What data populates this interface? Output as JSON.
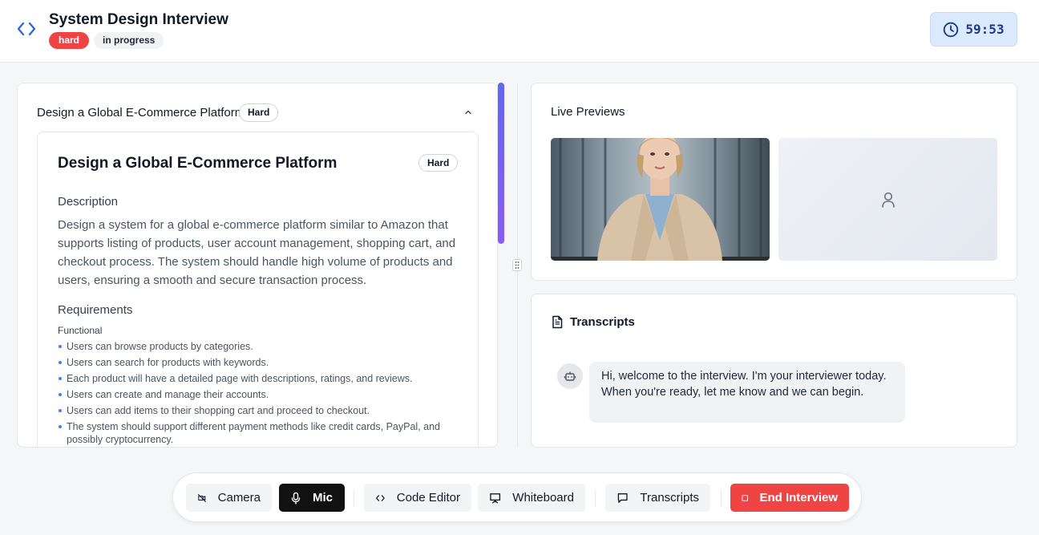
{
  "header": {
    "title": "System Design Interview",
    "difficulty_badge": "hard",
    "status_badge": "in progress",
    "timer": "59:53"
  },
  "problem": {
    "header_title": "Design a Global E-Commerce Platform",
    "header_badge": "Hard",
    "title": "Design a Global E-Commerce Platform",
    "badge": "Hard",
    "description_heading": "Description",
    "description": "Design a system for a global e-commerce platform similar to Amazon that supports listing of products, user account management, shopping cart, and checkout process. The system should handle high volume of products and users, ensuring a smooth and secure transaction process.",
    "requirements_heading": "Requirements",
    "functional_label": "Functional",
    "functional_items": [
      "Users can browse products by categories.",
      "Users can search for products with keywords.",
      "Each product will have a detailed page with descriptions, ratings, and reviews.",
      "Users can create and manage their accounts.",
      "Users can add items to their shopping cart and proceed to checkout.",
      "The system should support different payment methods like credit cards, PayPal, and possibly cryptocurrency."
    ]
  },
  "previews": {
    "title": "Live Previews"
  },
  "transcripts": {
    "title": "Transcripts",
    "messages": [
      {
        "role": "interviewer",
        "text": "Hi, welcome to the interview. I'm your interviewer today. When you're ready, let me know and we can begin."
      }
    ]
  },
  "toolbar": {
    "camera": "Camera",
    "mic": "Mic",
    "code_editor": "Code Editor",
    "whiteboard": "Whiteboard",
    "transcripts": "Transcripts",
    "end_interview": "End Interview"
  },
  "colors": {
    "accent_red": "#ef4444",
    "timer_bg": "#dbeafe",
    "timer_text": "#1e3a8a",
    "bullet": "#3b82f6"
  }
}
